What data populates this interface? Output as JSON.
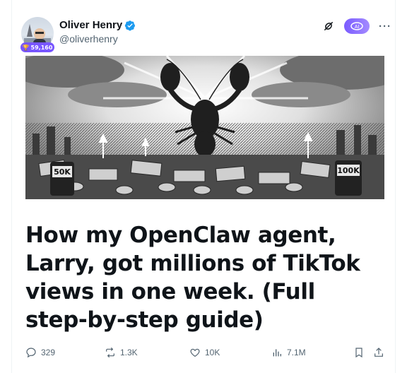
{
  "author": {
    "name": "Oliver Henry",
    "handle": "@oliverhenry",
    "badge_count": "59,160",
    "verified_icon": "verified-badge-icon"
  },
  "header_icons": {
    "ai_label": "AI",
    "more": "···"
  },
  "banner": {
    "label_left": "50K",
    "label_right": "100K"
  },
  "article": {
    "title": "How my OpenClaw agent, Larry, got millions of TikTok views in one week. (Full step-by-step guide)"
  },
  "actions": {
    "replies": "329",
    "reposts": "1.3K",
    "likes": "10K",
    "views": "7.1M"
  },
  "colors": {
    "accent": "#1d9bf0",
    "grok": "#7856ff",
    "muted": "#536471"
  }
}
